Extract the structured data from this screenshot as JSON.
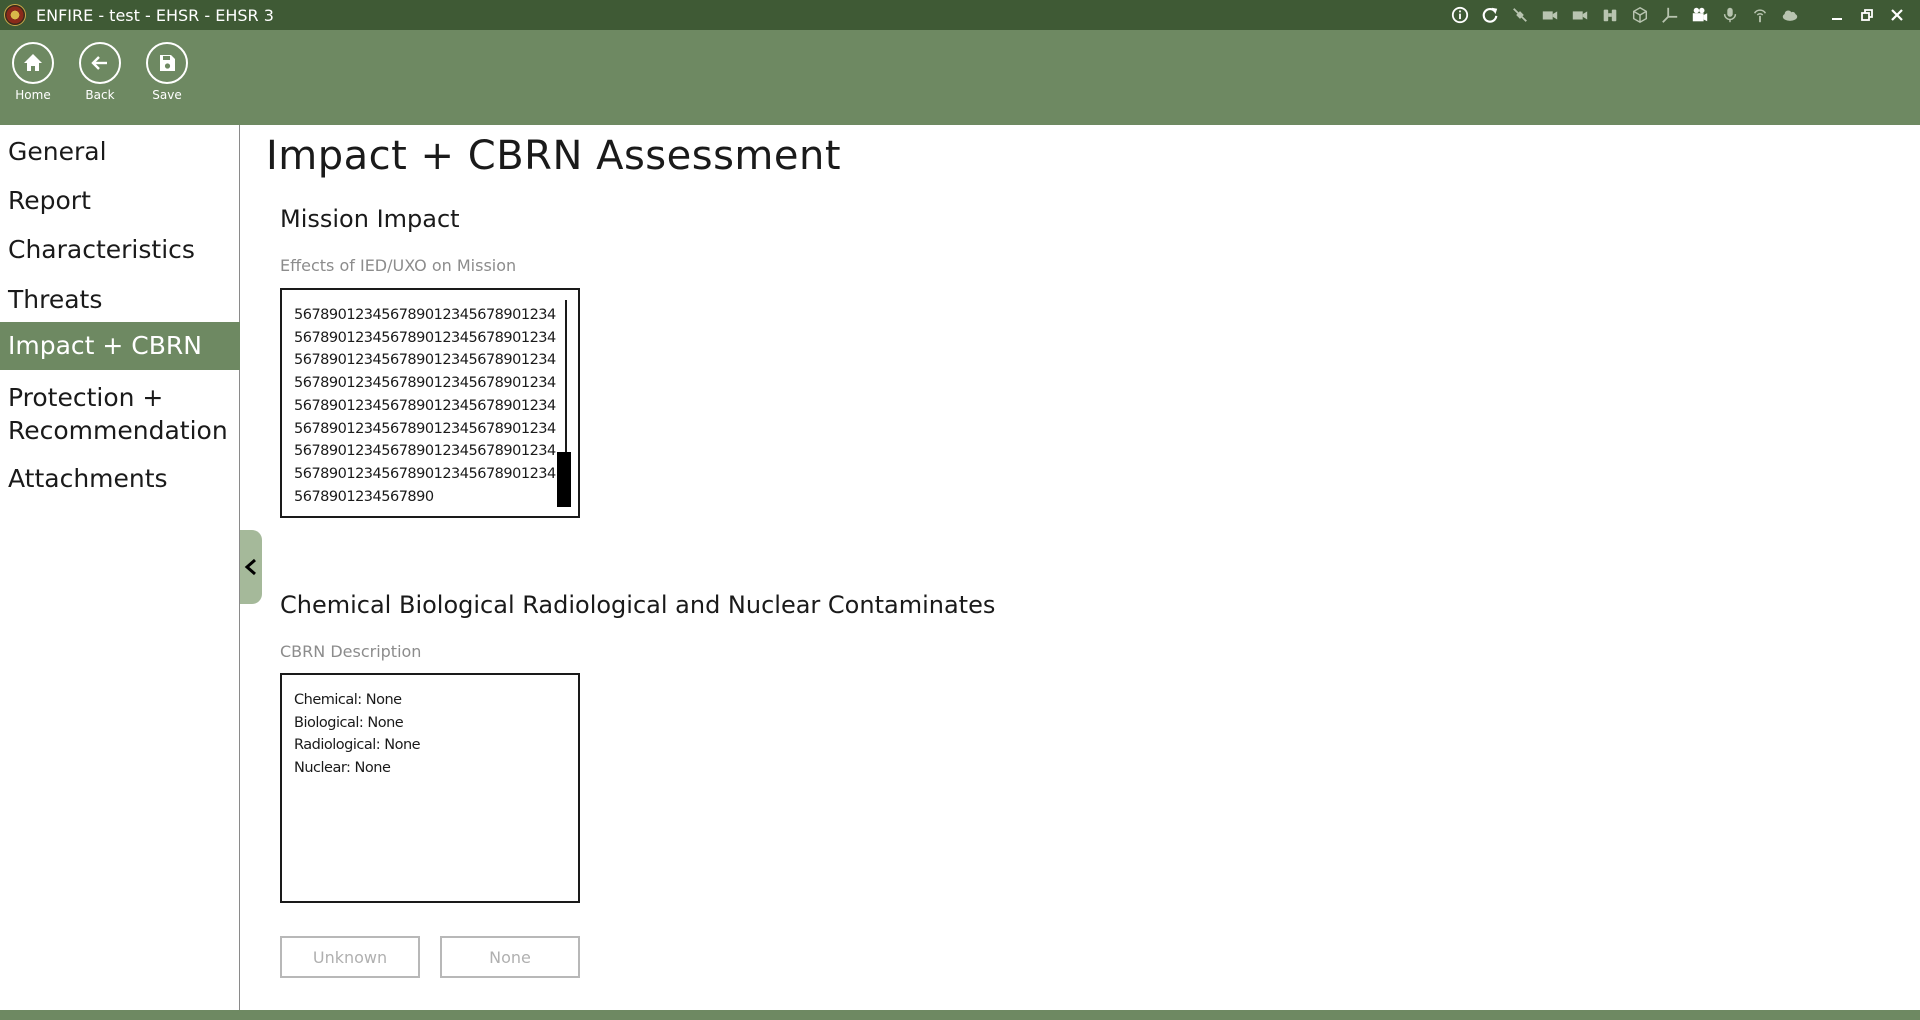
{
  "window": {
    "title": "ENFIRE - test - EHSR - EHSR 3"
  },
  "titlebar_icons": [
    "info-icon",
    "refresh-icon",
    "satellite-icon",
    "camera-icon",
    "video-icon",
    "binoculars-icon",
    "cube-icon",
    "axes-icon",
    "camcorder-icon",
    "microphone-icon",
    "antenna-icon",
    "cloud-icon"
  ],
  "toolbar": {
    "home_label": "Home",
    "back_label": "Back",
    "save_label": "Save"
  },
  "sidebar": {
    "items": [
      {
        "label": "General",
        "active": false
      },
      {
        "label": "Report",
        "active": false
      },
      {
        "label": "Characteristics",
        "active": false
      },
      {
        "label": "Threats",
        "active": false
      },
      {
        "label": "Impact + CBRN",
        "active": true
      },
      {
        "label": "Protection +\nRecommendation",
        "active": false
      },
      {
        "label": "Attachments",
        "active": false
      }
    ]
  },
  "main": {
    "page_title": "Impact + CBRN Assessment",
    "mission": {
      "section_title": "Mission Impact",
      "field_label": "Effects of IED/UXO on Mission",
      "value": "5678901234567890123456789012345678901234567890123456789012345678901234567890123456789012345678901234567890123456789012345678901234567890123456789012345678901234567890123456789012345678901234567890123456789012345678901234567890123456789012345678901234567890"
    },
    "cbrn": {
      "section_title": "Chemical Biological Radiological and Nuclear Contaminates",
      "field_label": "CBRN Description",
      "value": "Chemical: None\nBiological: None\nRadiological: None\nNuclear: None",
      "unknown_label": "Unknown",
      "none_label": "None"
    }
  },
  "colors": {
    "titlebar": "#3f5a35",
    "toolbar": "#6e8962",
    "active_nav": "#6e8962",
    "collapse_tab": "#a5b99a"
  }
}
